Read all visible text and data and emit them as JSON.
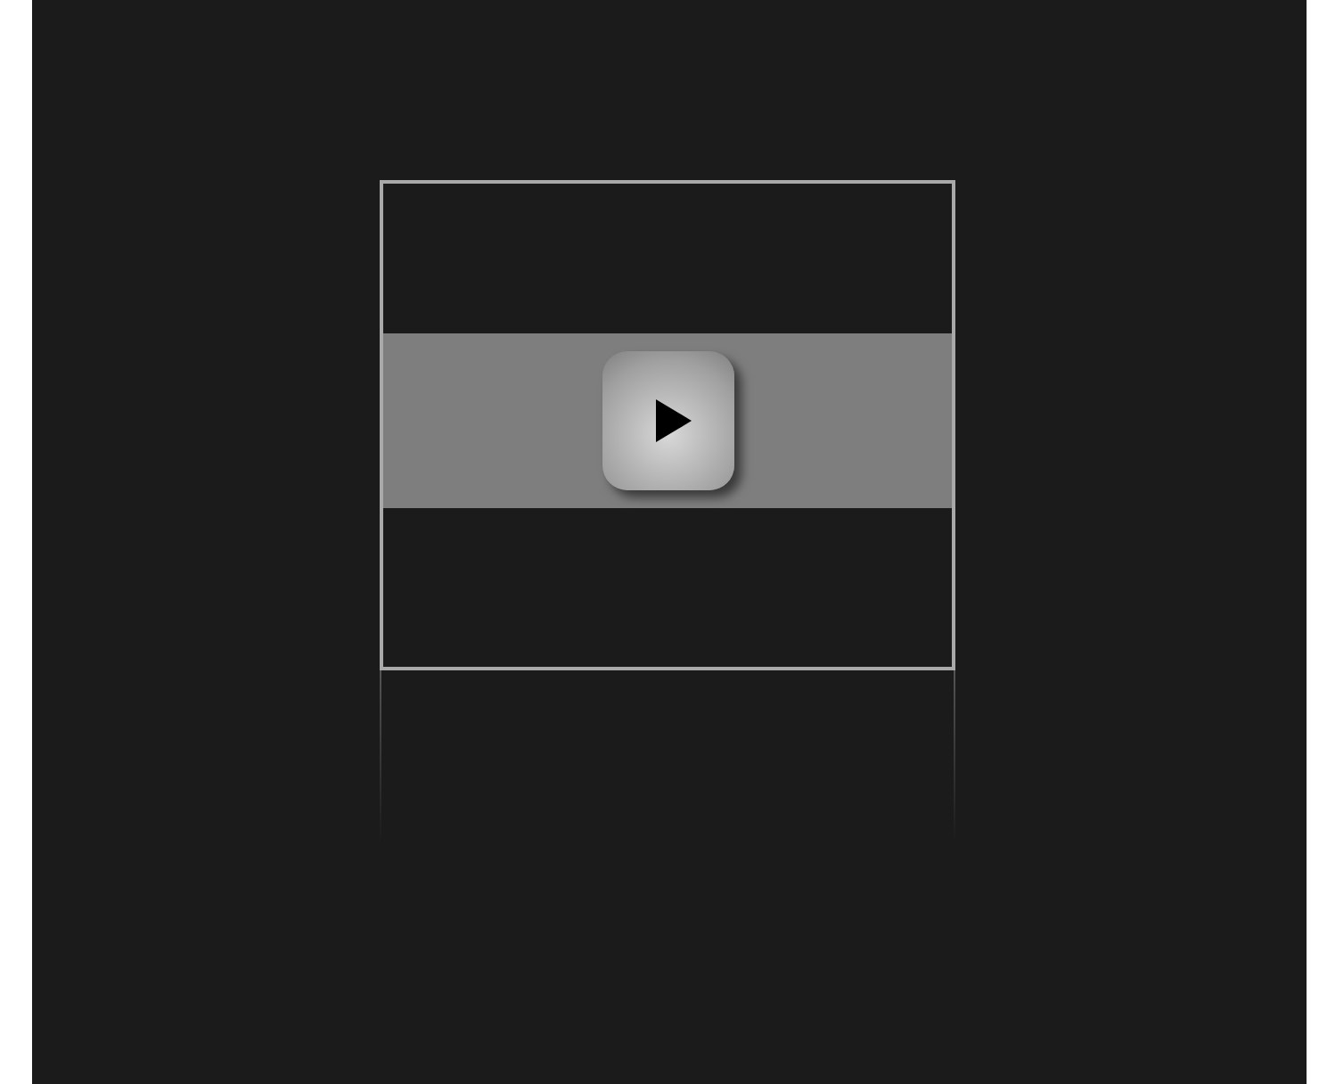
{
  "player": {
    "playing": false
  }
}
